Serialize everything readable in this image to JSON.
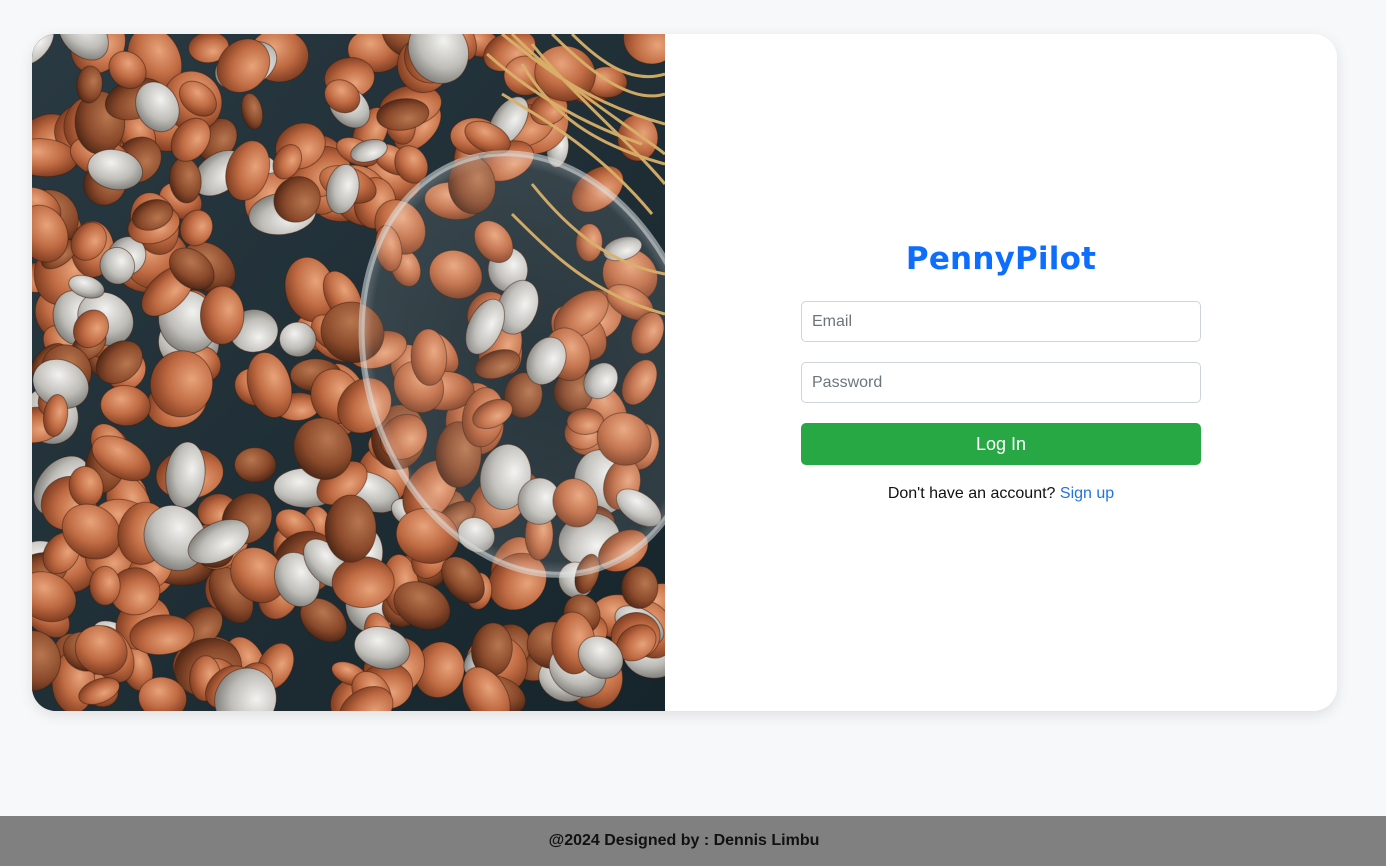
{
  "brand": {
    "name": "PennyPilot"
  },
  "hero": {
    "image_description": "coins spilling from a glass jar",
    "icon": "coins-photo"
  },
  "login_form": {
    "email": {
      "placeholder": "Email",
      "value": ""
    },
    "password": {
      "placeholder": "Password",
      "value": ""
    },
    "submit_label": "Log In",
    "signup_prompt": "Don't have an account?",
    "signup_link": "Sign up"
  },
  "footer": {
    "text": "@2024 Designed by : Dennis Limbu"
  },
  "colors": {
    "brand": "#0d6efd",
    "login_button": "#28a745",
    "link": "#1f74e0",
    "footer_bg": "#808080",
    "page_bg": "#f7f8fa"
  }
}
